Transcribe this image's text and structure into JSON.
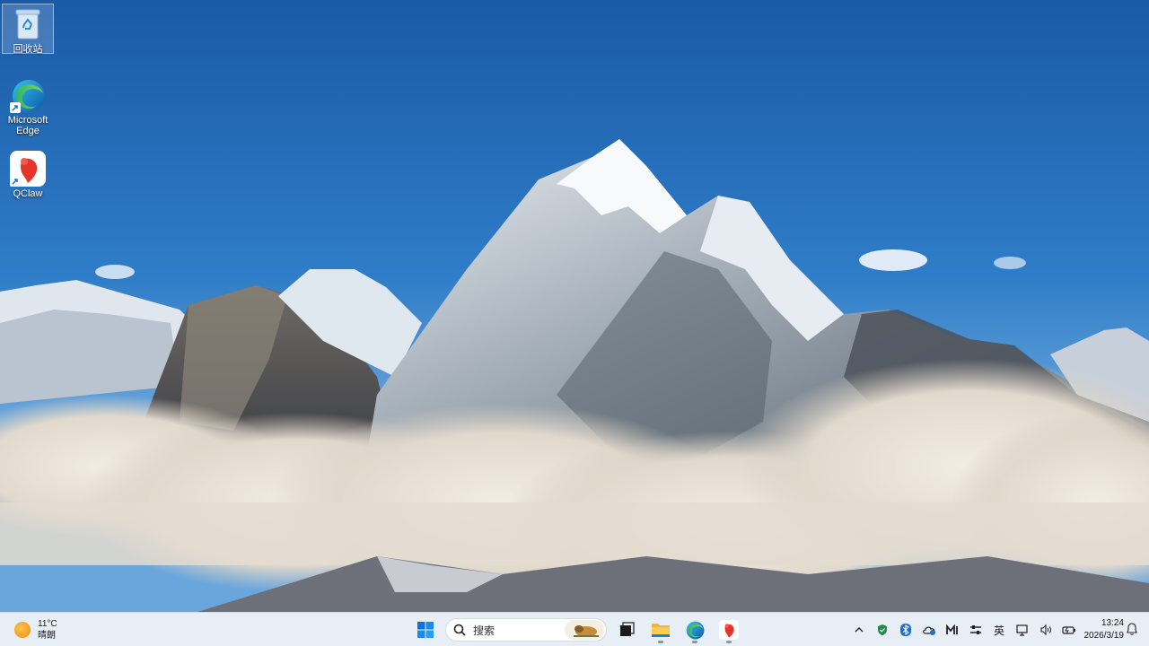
{
  "desktop": {
    "icons": [
      {
        "label": "回收站",
        "icon": "recycle-bin-icon"
      },
      {
        "label": "Microsoft Edge",
        "icon": "edge-icon"
      },
      {
        "label": "QClaw",
        "icon": "qclaw-icon"
      }
    ]
  },
  "taskbar": {
    "weather": {
      "temperature": "11°C",
      "condition": "晴朗",
      "icon": "sun-icon"
    },
    "search": {
      "placeholder": "搜索"
    },
    "pinned": [
      {
        "icon": "start-icon"
      },
      {
        "icon": "task-view-icon"
      },
      {
        "icon": "file-explorer-icon"
      },
      {
        "icon": "edge-icon"
      },
      {
        "icon": "qclaw-icon"
      }
    ],
    "tray": {
      "input_method": "英",
      "icons": [
        "chevron-up-icon",
        "security-icon",
        "bluetooth-icon",
        "onedrive-icon",
        "app-icon",
        "settings-sliders-icon",
        "network-icon",
        "volume-icon",
        "battery-icon"
      ]
    },
    "clock": {
      "time": "13:24",
      "date": "2026/3/19"
    }
  },
  "colors": {
    "taskbar_bg": "#e8eef5",
    "windows_blue": "#0078d4",
    "sky": "#2f7cc4"
  }
}
